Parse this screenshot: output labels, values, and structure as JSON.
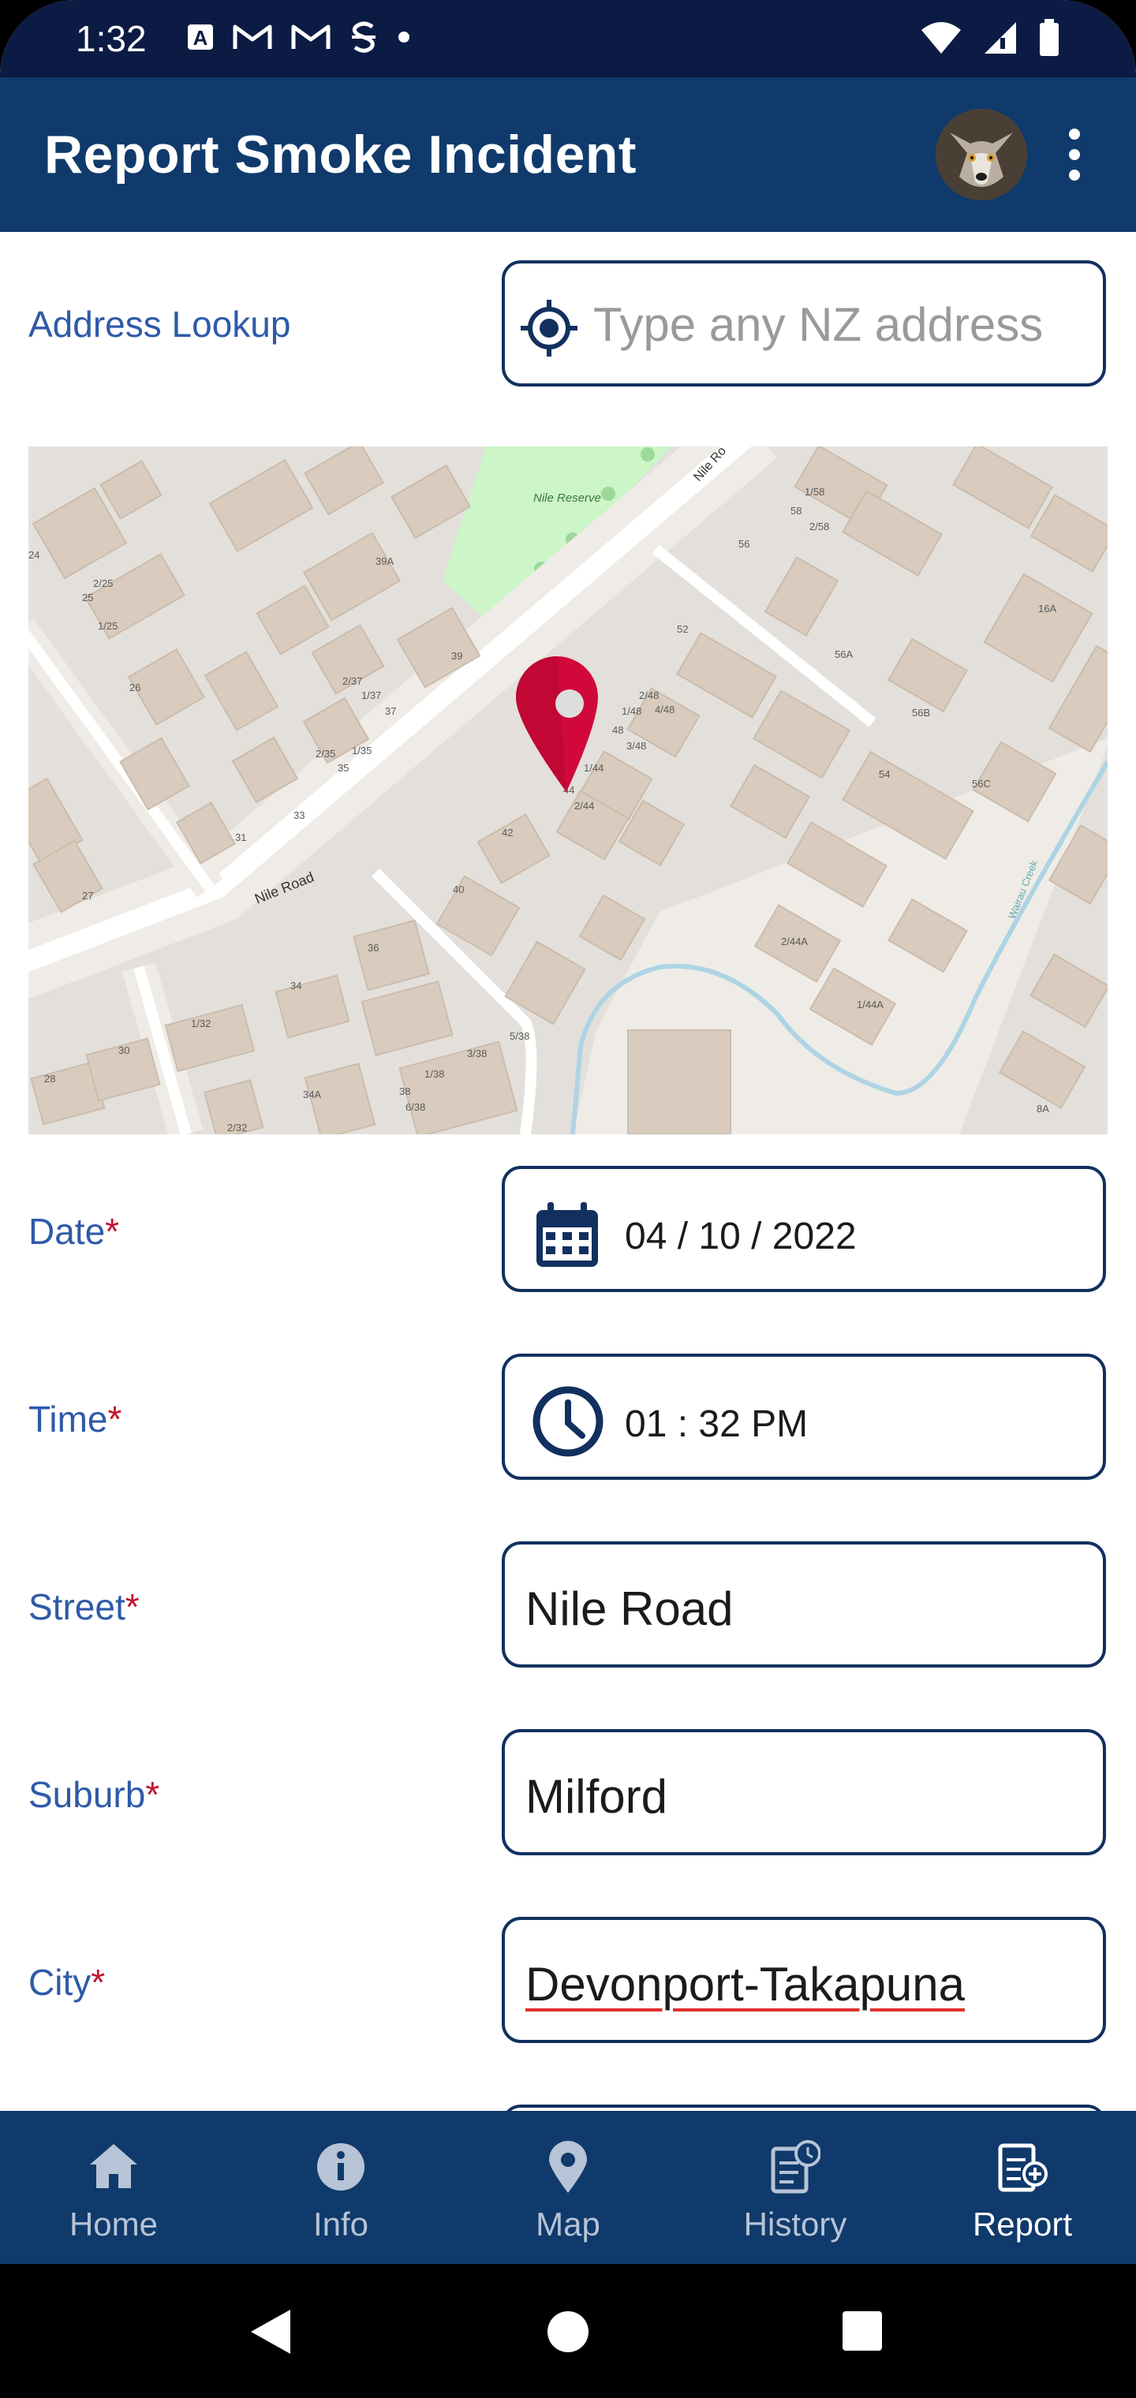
{
  "status_bar": {
    "time": "1:32",
    "left_icons": [
      "a-box-icon",
      "gmail-icon",
      "gmail-icon",
      "s-icon",
      "dot-icon"
    ],
    "right_icons": [
      "wifi-icon",
      "signal-icon",
      "battery-icon"
    ]
  },
  "app_bar": {
    "title": "Report Smoke Incident",
    "avatar_icon": "wolf-avatar",
    "menu_icon": "more-vert-icon"
  },
  "form": {
    "address_lookup": {
      "label": "Address Lookup",
      "placeholder": "Type any NZ address",
      "icon": "locate-icon"
    },
    "map": {
      "road_labels": [
        "Nile Road",
        "Nile Ro",
        "Wairau Creek"
      ],
      "park_label": "Nile Reserve",
      "house_numbers": [
        "24",
        "2/25",
        "25",
        "1/25",
        "39A",
        "26",
        "2/37",
        "1/37",
        "37",
        "39",
        "2/35",
        "1/35",
        "35",
        "33",
        "31",
        "27",
        "56",
        "1/58",
        "58",
        "2/58",
        "52",
        "56A",
        "2/48",
        "1/48",
        "4/48",
        "48",
        "3/48",
        "1/44",
        "44",
        "2/44",
        "16A",
        "56B",
        "54",
        "56C",
        "42",
        "40",
        "36",
        "2/44A",
        "1/44A",
        "34",
        "1/32",
        "30",
        "28",
        "34A",
        "2/32",
        "1/38",
        "38",
        "3/38",
        "6/38",
        "5/38",
        "8A"
      ],
      "marker_icon": "map-pin-icon"
    },
    "date": {
      "label": "Date",
      "required_mark": "*",
      "value": "04 / 10 / 2022",
      "icon": "calendar-icon"
    },
    "time": {
      "label": "Time",
      "required_mark": "*",
      "value": "01 : 32 PM",
      "icon": "clock-icon"
    },
    "street": {
      "label": "Street",
      "required_mark": "*",
      "value": "Nile Road"
    },
    "suburb": {
      "label": "Suburb",
      "required_mark": "*",
      "value": "Milford"
    },
    "city": {
      "label": "City",
      "required_mark": "*",
      "value": "Devonport-Takapuna"
    }
  },
  "bottom_nav": {
    "items": [
      {
        "label": "Home",
        "icon": "home-icon",
        "active": false
      },
      {
        "label": "Info",
        "icon": "info-icon",
        "active": false
      },
      {
        "label": "Map",
        "icon": "map-marker-icon",
        "active": false
      },
      {
        "label": "History",
        "icon": "history-icon",
        "active": false
      },
      {
        "label": "Report",
        "icon": "report-add-icon",
        "active": true
      }
    ]
  },
  "system_nav": {
    "buttons": [
      "back-icon",
      "home-circle-icon",
      "recents-icon"
    ]
  },
  "colors": {
    "primary": "#0f3a6b",
    "status_bar": "#0b1b43",
    "label": "#2e5aa8",
    "required": "#c4102e",
    "field_border": "#12305f",
    "nav_inactive": "#b7c3d6",
    "nav_active": "#ffffff",
    "map_pin": "#d1093a"
  }
}
